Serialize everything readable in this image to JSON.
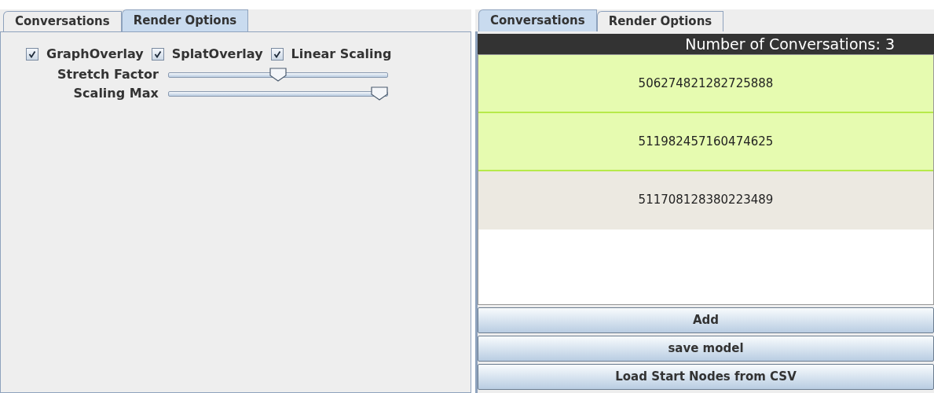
{
  "left_panel": {
    "tabs": [
      {
        "label": "Conversations",
        "selected": false
      },
      {
        "label": "Render Options",
        "selected": true
      }
    ],
    "checkboxes": [
      {
        "label": "GraphOverlay",
        "checked": true
      },
      {
        "label": "SplatOverlay",
        "checked": true
      },
      {
        "label": "Linear Scaling",
        "checked": true
      }
    ],
    "sliders": [
      {
        "label": "Stretch Factor",
        "level": 0.5
      },
      {
        "label": "Scaling Max",
        "level": 1
      }
    ]
  },
  "right_panel": {
    "tabs": [
      {
        "label": "Conversations",
        "selected": true
      },
      {
        "label": "Render Options",
        "selected": false
      }
    ],
    "header": "Number of Conversations: 3",
    "conversations": [
      {
        "id": "506274821282725888",
        "selected": true
      },
      {
        "id": "511982457160474625",
        "selected": true
      },
      {
        "id": "511708128380223489",
        "selected": false
      }
    ],
    "buttons": [
      "Add",
      "save model",
      "Load Start Nodes from CSV"
    ]
  }
}
